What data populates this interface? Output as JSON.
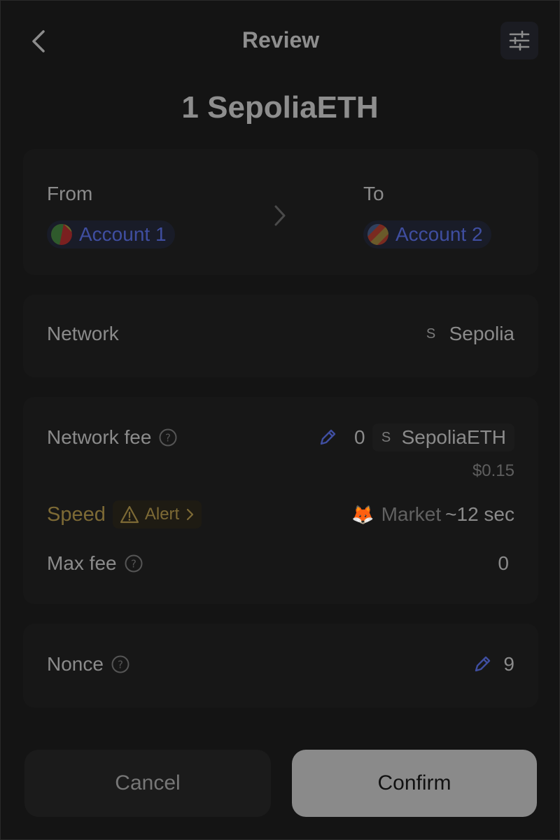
{
  "header": {
    "title": "Review",
    "back_icon": "chevron-left-icon",
    "settings_icon": "sliders-icon"
  },
  "amount": "1 SepoliaETH",
  "transfer": {
    "from_label": "From",
    "from_account": "Account 1",
    "to_label": "To",
    "to_account": "Account 2"
  },
  "network": {
    "label": "Network",
    "badge": "S",
    "value": "Sepolia"
  },
  "fee": {
    "label": "Network fee",
    "amount": "0",
    "token_badge": "S",
    "token": "SepoliaETH",
    "fiat": "$0.15",
    "speed_label": "Speed",
    "alert_label": "Alert",
    "market_emoji": "🦊",
    "market_label": "Market",
    "market_time": "~12 sec",
    "max_fee_label": "Max fee",
    "max_fee_value": "0"
  },
  "nonce": {
    "label": "Nonce",
    "value": "9"
  },
  "buttons": {
    "cancel": "Cancel",
    "confirm": "Confirm"
  },
  "colors": {
    "accent_blue": "#3f4ea0",
    "warning": "#7d6a35",
    "confirm_bg": "#8a8a8a"
  }
}
